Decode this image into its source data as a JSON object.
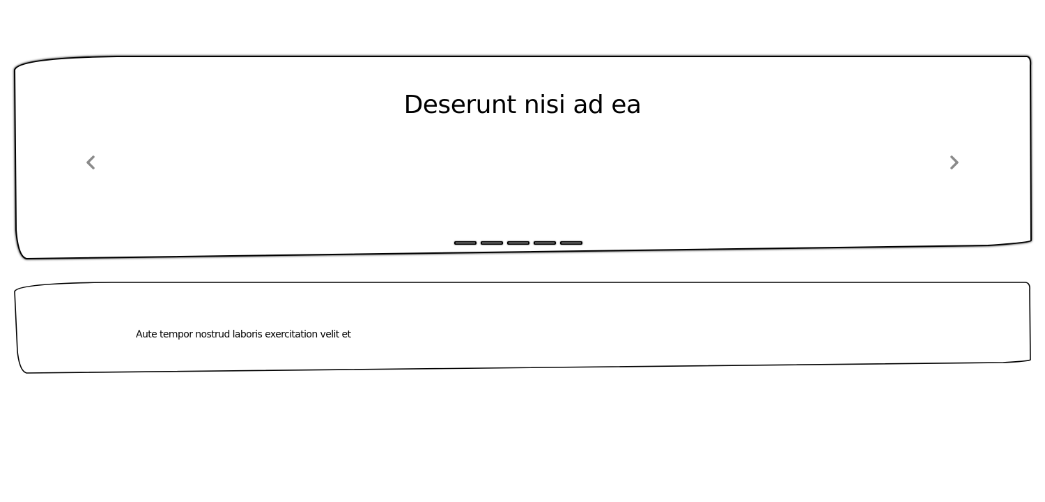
{
  "carousel": {
    "slide_title": "Deserunt nisi ad ea",
    "prev_icon": "chevron-left-icon",
    "next_icon": "chevron-right-icon",
    "indicator_count": 5,
    "arrow_color": "#8a8a8a"
  },
  "card": {
    "text": "Aute tempor nostrud laboris exercitation velit et"
  }
}
